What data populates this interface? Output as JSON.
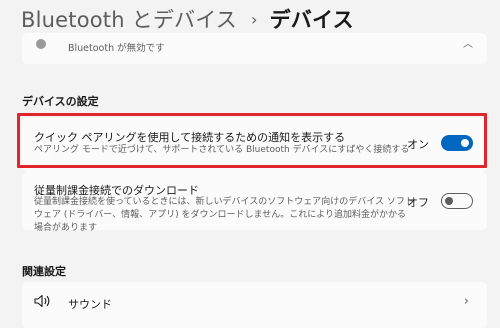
{
  "breadcrumb": {
    "parent": "Bluetooth とデバイス",
    "separator": "›",
    "current": "デバイス"
  },
  "bluetooth_status": {
    "text": "Bluetooth が無効です",
    "chevron": "︿"
  },
  "device_settings": {
    "heading": "デバイスの設定",
    "notification": {
      "title": "クイック ペアリングを使用して接続するための通知を表示する",
      "description": "ペアリング モードで近づけて、サポートされている Bluetooth デバイスにすばやく接続する",
      "toggle_label": "オン",
      "toggle_state": "on"
    },
    "metered": {
      "title": "従量制課金接続でのダウンロード",
      "description": "従量制課金接続を使っているときには、新しいデバイスのソフトウェア向けのデバイス ソフトウェア (ドライバー、情報、アプリ) をダウンロードしません。これにより追加料金がかかる場合があります",
      "toggle_label": "オフ",
      "toggle_state": "off"
    }
  },
  "related": {
    "heading": "関連設定",
    "sound": {
      "label": "サウンド",
      "icon": "speaker-icon",
      "chevron": "›"
    }
  },
  "colors": {
    "accent": "#0067c0",
    "highlight_border": "#e0252d",
    "background": "#f3f3f3",
    "card": "#fbfbfb"
  }
}
